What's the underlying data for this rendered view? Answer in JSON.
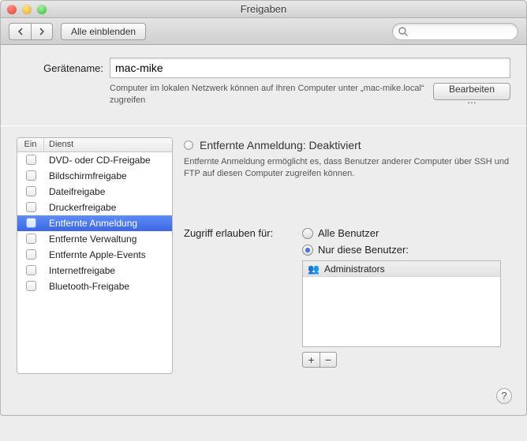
{
  "window": {
    "title": "Freigaben"
  },
  "toolbar": {
    "show_all": "Alle einblenden"
  },
  "search": {
    "placeholder": ""
  },
  "device": {
    "label": "Gerätename:",
    "value": "mac-mike",
    "hint": "Computer im lokalen Netzwerk können auf Ihren Computer unter „mac-mike.local“ zugreifen",
    "edit_label": "Bearbeiten …"
  },
  "list": {
    "col_on": "Ein",
    "col_service": "Dienst",
    "items": [
      {
        "label": "DVD- oder CD-Freigabe",
        "on": false,
        "selected": false
      },
      {
        "label": "Bildschirmfreigabe",
        "on": false,
        "selected": false
      },
      {
        "label": "Dateifreigabe",
        "on": false,
        "selected": false
      },
      {
        "label": "Druckerfreigabe",
        "on": false,
        "selected": false
      },
      {
        "label": "Entfernte Anmeldung",
        "on": false,
        "selected": true
      },
      {
        "label": "Entfernte Verwaltung",
        "on": false,
        "selected": false
      },
      {
        "label": "Entfernte Apple-Events",
        "on": false,
        "selected": false
      },
      {
        "label": "Internetfreigabe",
        "on": false,
        "selected": false
      },
      {
        "label": "Bluetooth-Freigabe",
        "on": false,
        "selected": false
      }
    ]
  },
  "detail": {
    "status_title": "Entfernte Anmeldung: Deaktiviert",
    "status_desc": "Entfernte Anmeldung ermöglicht es, dass Benutzer anderer Computer über SSH und FTP auf diesen Computer zugreifen können.",
    "access_label": "Zugriff erlauben für:",
    "radio_all": "Alle Benutzer",
    "radio_only": "Nur diese Benutzer:",
    "users": [
      {
        "label": "Administrators"
      }
    ]
  },
  "icons": {
    "plus": "+",
    "minus": "−",
    "help": "?"
  }
}
